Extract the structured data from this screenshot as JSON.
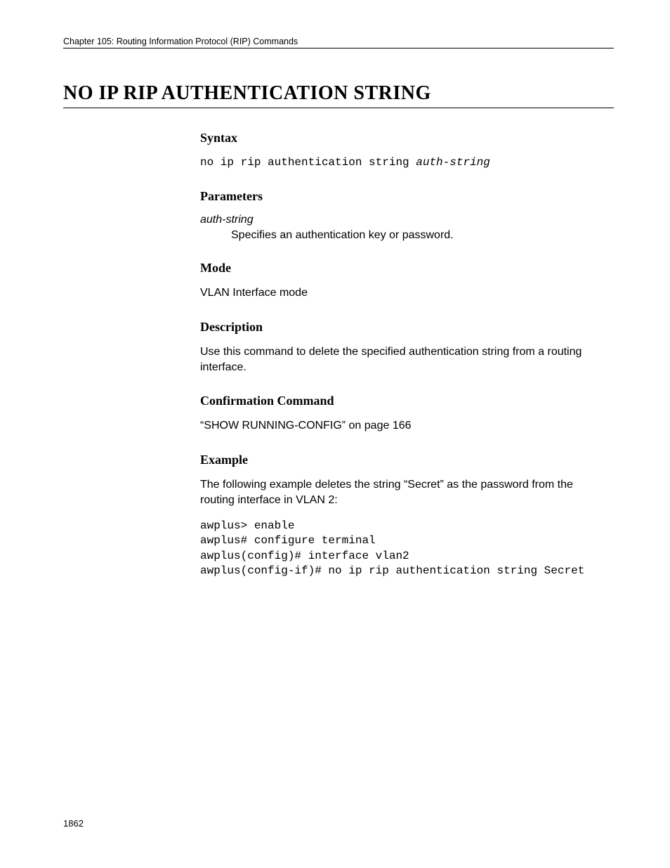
{
  "header": {
    "chapter": "Chapter 105: Routing Information Protocol (RIP) Commands"
  },
  "title": "NO IP RIP AUTHENTICATION STRING",
  "sections": {
    "syntax": {
      "heading": "Syntax",
      "command_prefix": "no ip rip authentication string ",
      "command_arg": "auth-string"
    },
    "parameters": {
      "heading": "Parameters",
      "param_name": "auth-string",
      "param_desc": "Specifies an authentication key or password."
    },
    "mode": {
      "heading": "Mode",
      "text": "VLAN Interface mode"
    },
    "description": {
      "heading": "Description",
      "text": "Use this command to delete the specified authentication string from a routing interface."
    },
    "confirmation": {
      "heading": "Confirmation Command",
      "text": "“SHOW RUNNING-CONFIG” on page 166"
    },
    "example": {
      "heading": "Example",
      "intro": "The following example deletes the string “Secret” as the password from the routing interface in VLAN 2:",
      "code": "awplus> enable\nawplus# configure terminal\nawplus(config)# interface vlan2\nawplus(config-if)# no ip rip authentication string Secret"
    }
  },
  "page_number": "1862"
}
